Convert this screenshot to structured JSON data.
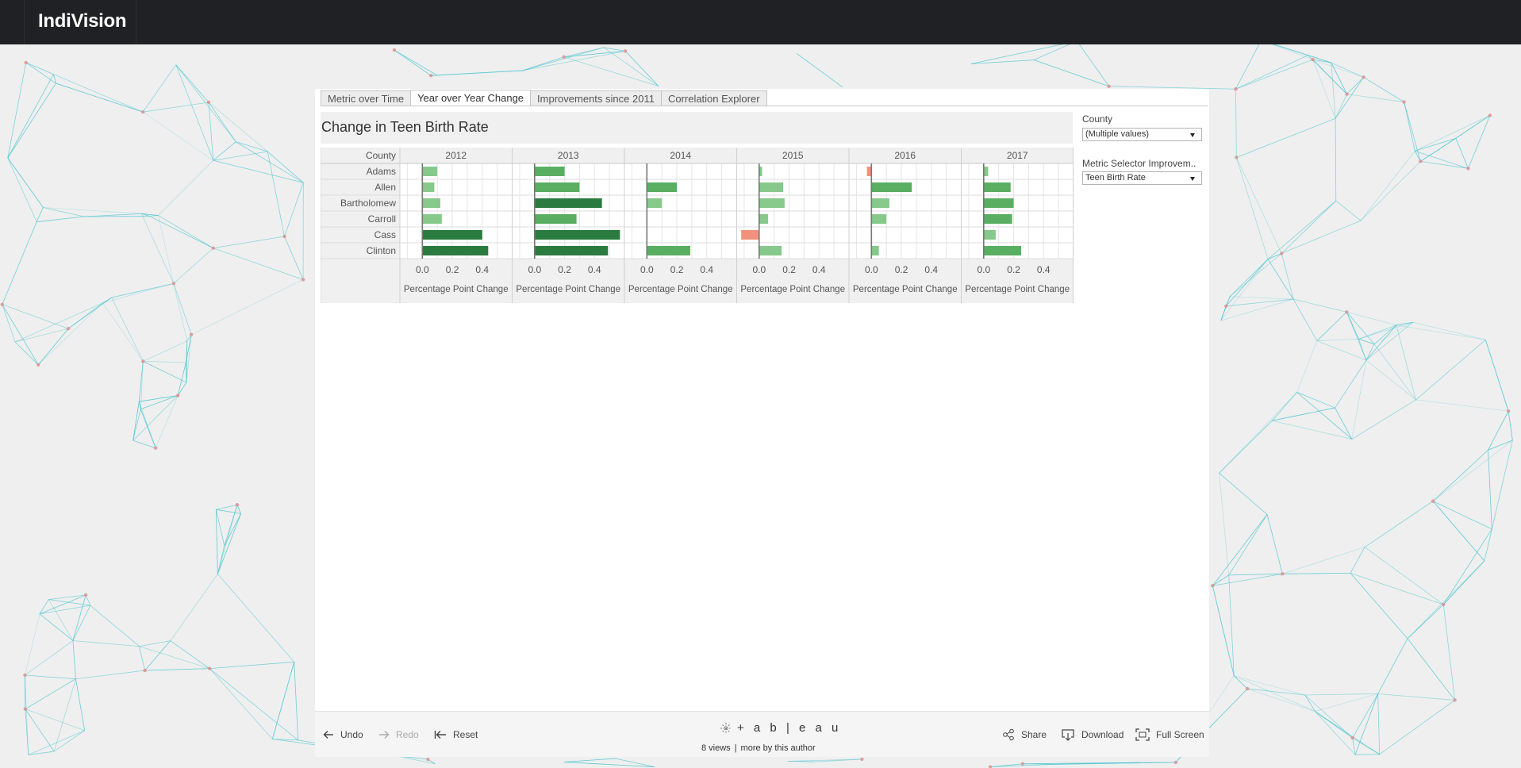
{
  "app": {
    "brand": "IndiVision"
  },
  "tabs": [
    {
      "label": "Metric over Time",
      "active": false
    },
    {
      "label": "Year over Year Change",
      "active": true
    },
    {
      "label": "Improvements since 2011",
      "active": false
    },
    {
      "label": "Correlation Explorer",
      "active": false
    }
  ],
  "viz": {
    "title": "Change in Teen Birth Rate"
  },
  "filters": {
    "county": {
      "label": "County",
      "value": "(Multiple values)"
    },
    "metric": {
      "label": "Metric Selector Improvem..",
      "value": "Teen Birth Rate"
    }
  },
  "chart_data": {
    "type": "bar",
    "orientation": "horizontal",
    "title": "Change in Teen Birth Rate",
    "row_header": "County",
    "categories": [
      "Adams",
      "Allen",
      "Bartholomew",
      "Carroll",
      "Cass",
      "Clinton"
    ],
    "panels": [
      {
        "year": "2012",
        "values": [
          0.1,
          0.08,
          0.12,
          0.13,
          0.4,
          0.44
        ]
      },
      {
        "year": "2013",
        "values": [
          0.2,
          0.3,
          0.45,
          0.28,
          0.57,
          0.49
        ]
      },
      {
        "year": "2014",
        "values": [
          0.0,
          0.2,
          0.1,
          0.0,
          0.0,
          0.29
        ]
      },
      {
        "year": "2015",
        "values": [
          0.02,
          0.16,
          0.17,
          0.06,
          -0.12,
          0.15
        ]
      },
      {
        "year": "2016",
        "values": [
          -0.03,
          0.27,
          0.12,
          0.1,
          0.0,
          0.05
        ]
      },
      {
        "year": "2017",
        "values": [
          0.03,
          0.18,
          0.2,
          0.19,
          0.08,
          0.25
        ]
      }
    ],
    "x_ticks": [
      "0.0",
      "0.2",
      "0.4"
    ],
    "xlabel": "Percentage Point Change",
    "xlim": [
      -0.15,
      0.6
    ],
    "grid": true,
    "colors": {
      "positive_light": "#86c98b",
      "positive_mid": "#5aae61",
      "positive_dark": "#2b7a3f",
      "negative": "#f4917d"
    }
  },
  "toolbar": {
    "undo": "Undo",
    "redo": "Redo",
    "reset": "Reset",
    "tableau": "+ a b | e a u",
    "views": "8 views",
    "more": "more by this author",
    "share": "Share",
    "download": "Download",
    "fullscreen": "Full Screen"
  }
}
